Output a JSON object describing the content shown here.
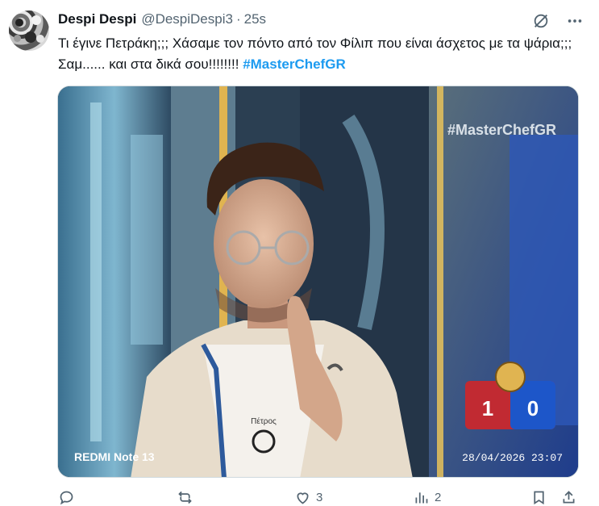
{
  "tweet": {
    "author_name": "Despi Despi",
    "author_handle": "@DespiDespi3",
    "separator": "·",
    "timestamp": "25s",
    "text": "Τι έγινε Πετράκη;;; Χάσαμε τον πόντο από τον Φίλιπ που είναι άσχετος με τα ψάρια;;;  Σαμ...... και στα δικά σου!!!!!!!!",
    "hashtag": "#MasterChefGR"
  },
  "media": {
    "overlay_hashtag": "#MasterChefGR",
    "score_left": "1",
    "score_right": "0",
    "device_label": "REDMI Note 13",
    "photo_datetime": "28/04/2026 23:07",
    "apron_name": "Πέτρος"
  },
  "actions": {
    "reply_count": "",
    "retweet_count": "",
    "like_count": "3",
    "views_count": "2"
  },
  "colors": {
    "accent": "#1d9bf0",
    "muted": "#536471",
    "text": "#0f1419"
  },
  "icons": {
    "grok": "grok-icon",
    "more": "more-icon",
    "reply": "reply-icon",
    "retweet": "retweet-icon",
    "like": "like-icon",
    "views": "views-icon",
    "bookmark": "bookmark-icon",
    "share": "share-icon"
  }
}
